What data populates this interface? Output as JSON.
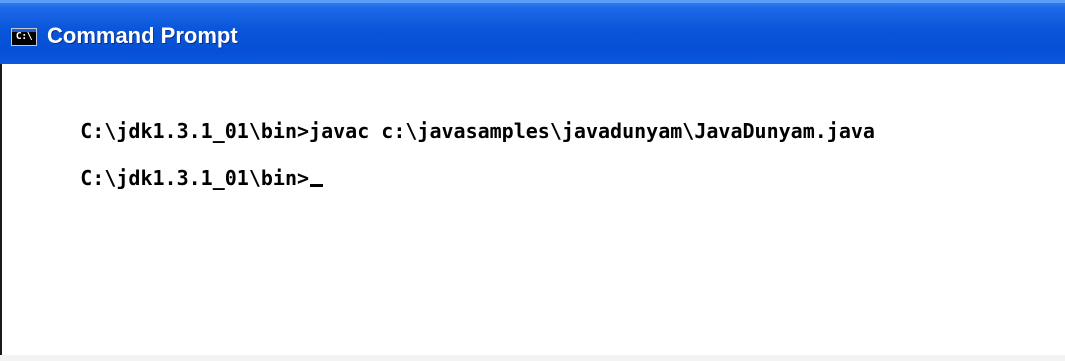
{
  "window": {
    "title": "Command Prompt",
    "icon": {
      "name": "command-prompt-icon",
      "glyph": "C:\\"
    }
  },
  "console": {
    "lines": [
      "C:\\jdk1.3.1_01\\bin>javac c:\\javasamples\\javadunyam\\JavaDunyam.java",
      "C:\\jdk1.3.1_01\\bin>"
    ]
  },
  "colors": {
    "title_bar": "#0a56da",
    "title_text": "#ffffff",
    "console_background": "#ffffff",
    "console_text": "#000000"
  }
}
